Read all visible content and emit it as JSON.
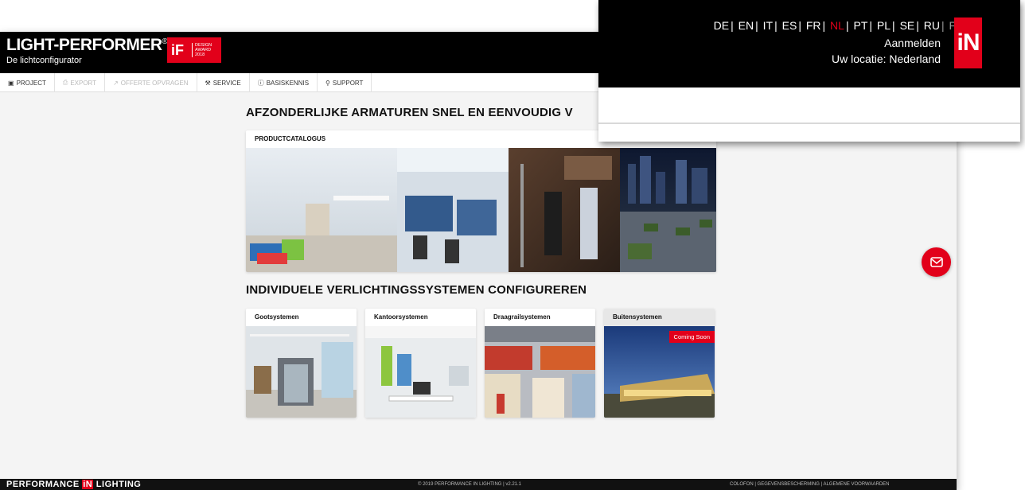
{
  "app": {
    "brand_title": "LIGHT-PERFORMER",
    "brand_reg": "®",
    "brand_subtitle": "De lichtconfigurator",
    "if_logo": "iF",
    "if_award": [
      "DESIGN",
      "AWARD",
      "2018"
    ]
  },
  "toolbar": {
    "items": [
      {
        "label": "PROJECT",
        "icon": "save-icon",
        "enabled": true
      },
      {
        "label": "EXPORT",
        "icon": "print-icon",
        "enabled": false
      },
      {
        "label": "OFFERTE OPVRAGEN",
        "icon": "share-icon",
        "enabled": false
      },
      {
        "label": "SERVICE",
        "icon": "tools-icon",
        "enabled": true
      },
      {
        "label": "BASISKENNIS",
        "icon": "info-icon",
        "enabled": true
      },
      {
        "label": "SUPPORT",
        "icon": "lightbulb-icon",
        "enabled": true
      }
    ]
  },
  "main": {
    "heading1": "AFZONDERLIJKE ARMATUREN SNEL EN EENVOUDIG V",
    "catalog_label": "PRODUCTCATALOGUS",
    "heading2": "INDIVIDUELE VERLICHTINGSSYSTEMEN CONFIGUREREN",
    "systems": [
      {
        "label": "Gootsystemen"
      },
      {
        "label": "Kantoorsystemen"
      },
      {
        "label": "Draagrailsystemen"
      },
      {
        "label": "Buitensystemen",
        "badge": "Coming Soon"
      }
    ]
  },
  "footer": {
    "brand": "PERFORMANCE",
    "brand_mark": "iN",
    "brand_suffix": "LIGHTING",
    "copyright": "© 2019 PERFORMANCE IN LIGHTING | v2.21.1",
    "links": "COLOFON | GEGEVENSBESCHERMING | ALGEMENE VOORWAARDEN"
  },
  "zoom": {
    "languages": [
      "DE",
      "EN",
      "IT",
      "ES",
      "FR",
      "NL",
      "PT",
      "PL",
      "SE",
      "RU",
      "FI"
    ],
    "active_language": "NL",
    "login": "Aanmelden",
    "location": "Uw locatie: Nederland",
    "logo": "iN"
  },
  "colors": {
    "accent": "#e2001a",
    "header_bg": "#000000",
    "page_bg": "#f4f4f4"
  }
}
